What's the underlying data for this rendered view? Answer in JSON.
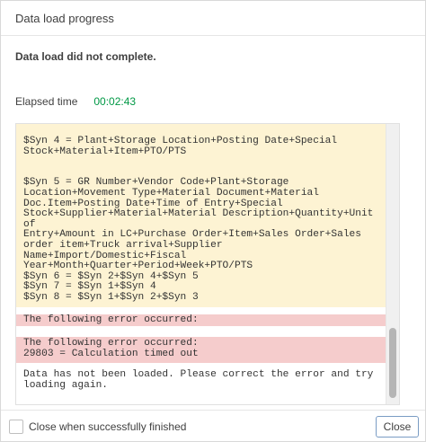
{
  "dialog": {
    "title": "Data load progress",
    "status": "Data load did not complete.",
    "elapsed_label": "Elapsed time",
    "elapsed_value": "00:02:43"
  },
  "log": {
    "yellow_block": "$Syn 4 = Plant+Storage Location+Posting Date+Special\nStock+Material+Item+PTO/PTS\n\n\n$Syn 5 = GR Number+Vendor Code+Plant+Storage\nLocation+Movement Type+Material Document+Material\nDoc.Item+Posting Date+Time of Entry+Special\nStock+Supplier+Material+Material Description+Quantity+Unit of\nEntry+Amount in LC+Purchase Order+Item+Sales Order+Sales\norder item+Truck arrival+Supplier Name+Import/Domestic+Fiscal\nYear+Month+Quarter+Period+Week+PTO/PTS\n$Syn 6 = $Syn 2+$Syn 4+$Syn 5\n$Syn 7 = $Syn 1+$Syn 4\n$Syn 8 = $Syn 1+$Syn 2+$Syn 3",
    "error1": "The following error occurred:",
    "error2": "The following error occurred:\n29803 = Calculation timed out",
    "final_message": "Data has not been loaded. Please correct the error and try\nloading again."
  },
  "footer": {
    "checkbox_label": "Close when successfully finished",
    "close_label": "Close"
  }
}
